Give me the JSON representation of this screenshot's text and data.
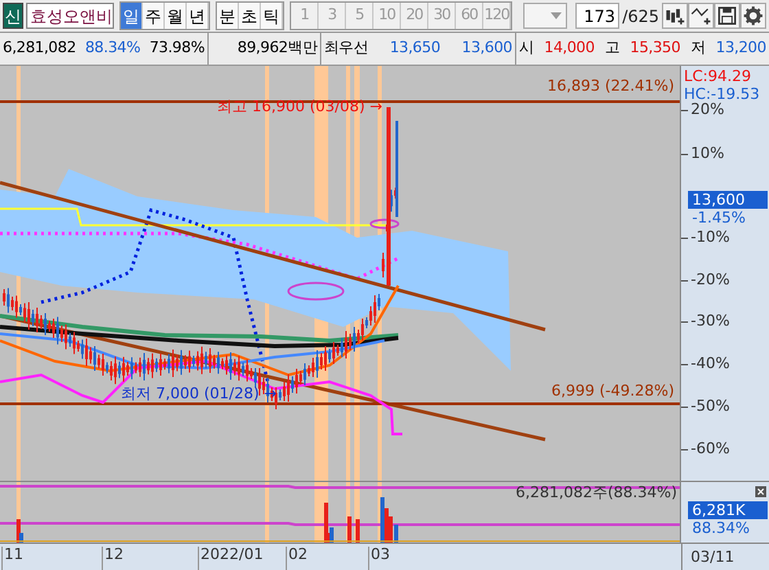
{
  "toolbar": {
    "market_badge": "신",
    "stock_name": "효성오앤비",
    "period_tabs": [
      {
        "label": "일",
        "selected": true
      },
      {
        "label": "주",
        "selected": false
      },
      {
        "label": "월",
        "selected": false
      },
      {
        "label": "년",
        "selected": false
      }
    ],
    "time_tabs": [
      {
        "label": "분",
        "selected": false
      },
      {
        "label": "초",
        "selected": false
      },
      {
        "label": "틱",
        "selected": false
      }
    ],
    "intervals": [
      {
        "label": "1",
        "disabled": true
      },
      {
        "label": "3",
        "disabled": true
      },
      {
        "label": "5",
        "disabled": true
      },
      {
        "label": "10",
        "disabled": true
      },
      {
        "label": "20",
        "disabled": true
      },
      {
        "label": "30",
        "disabled": true
      },
      {
        "label": "60",
        "disabled": true
      },
      {
        "label": "120",
        "disabled": true
      }
    ],
    "count": "173",
    "total": "/625"
  },
  "quote_bar": {
    "volume": "6,281,082",
    "volume_ratio": "88.34%",
    "ratio_2": "73.98%",
    "amount": "89,962백만",
    "best_label": "최우선",
    "ask": "13,650",
    "bid": "13,600",
    "open_label": "시",
    "open": "14,000",
    "high_label": "고",
    "high": "15,350",
    "low_label": "저",
    "low": "13,200"
  },
  "chart": {
    "lc": "LC:94.29",
    "hc": "HC:-19.53",
    "y_ticks": [
      "20%",
      "10%",
      "-10%",
      "-20%",
      "-30%",
      "-40%",
      "-50%",
      "-60%"
    ],
    "current_price": "13,600",
    "current_change": "-1.45%",
    "high_line_label": "16,893 (22.41%)",
    "high_marker": "최고 16,900 (03/08) →",
    "low_line_label": "6,999 (-49.28%)",
    "low_marker": "최저 7,000 (01/28) →"
  },
  "volume_panel": {
    "label": "6,281,082주(88.34%)",
    "current": "6,281K",
    "ratio": "88.34%"
  },
  "x_axis": {
    "labels": [
      "11",
      "12",
      "2022/01",
      "02",
      "03"
    ],
    "date": "03/11"
  }
}
